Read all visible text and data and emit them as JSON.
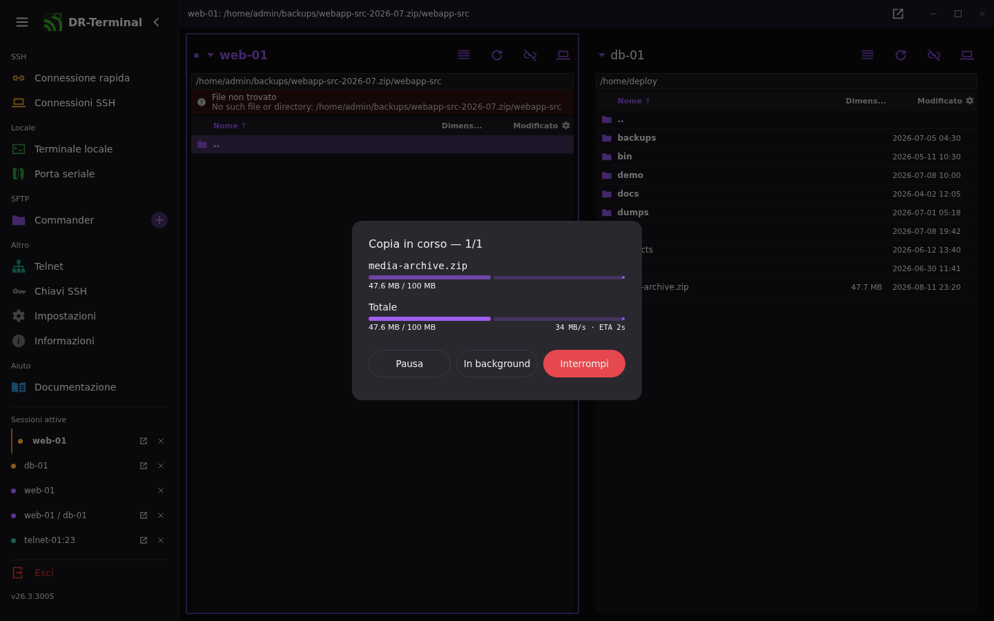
{
  "app": {
    "title": "DR-Terminal"
  },
  "sidebar": {
    "sections": [
      {
        "heading": "SSH",
        "items": [
          {
            "label": "Connessione rapida",
            "kind": "link"
          },
          {
            "label": "Connessioni SSH",
            "kind": "laptop"
          }
        ]
      },
      {
        "heading": "Locale",
        "items": [
          {
            "label": "Terminale locale",
            "kind": "terminal"
          },
          {
            "label": "Porta seriale",
            "kind": "serial"
          }
        ]
      },
      {
        "heading": "SFTP",
        "items": [
          {
            "label": "Commander",
            "kind": "folder",
            "add": true
          }
        ]
      },
      {
        "heading": "Altro",
        "items": [
          {
            "label": "Telnet",
            "kind": "network"
          },
          {
            "label": "Chiavi SSH",
            "kind": "key"
          },
          {
            "label": "Impostazioni",
            "kind": "gear"
          },
          {
            "label": "Informazioni",
            "kind": "info"
          }
        ]
      },
      {
        "heading": "Aiuto",
        "items": [
          {
            "label": "Documentazione",
            "kind": "book"
          }
        ]
      }
    ],
    "sessions_heading": "Sessioni attive",
    "sessions": [
      {
        "label": "web-01",
        "color": "#8a5a1e",
        "selected": true,
        "popout": true
      },
      {
        "label": "db-01",
        "color": "#8a5a1e",
        "selected": false,
        "popout": true
      },
      {
        "label": "web-01",
        "color": "#5a3590",
        "selected": false,
        "popout": false
      },
      {
        "label": "web-01 / db-01",
        "color": "#5a3590",
        "selected": false,
        "popout": true
      },
      {
        "label": "telnet-01:23",
        "color": "#1a5e55",
        "selected": false,
        "popout": true
      }
    ],
    "exit": "Esci",
    "version": "v26.3.3005"
  },
  "window": {
    "title": "web-01: /home/admin/backups/webapp-src-2026-07.zip/webapp-src"
  },
  "panels": [
    {
      "host": "web-01",
      "active": true,
      "path": "/home/admin/backups/webapp-src-2026-07.zip/webapp-src",
      "error": {
        "title": "File non trovato",
        "message": "No such file or directory: /home/admin/backups/webapp-src-2026-07.zip/webapp-src"
      },
      "columns": [
        "Nome ↑",
        "Dimens...",
        "Modificato"
      ],
      "rows": [
        {
          "name": "..",
          "kind": "folder",
          "selected": true
        }
      ]
    },
    {
      "host": "db-01",
      "active": false,
      "path": "/home/deploy",
      "columns": [
        "Nome ↑",
        "Dimens...",
        "Modificato"
      ],
      "rows": [
        {
          "name": "..",
          "kind": "folder",
          "selected": false
        },
        {
          "name": "backups",
          "kind": "folder",
          "modified": "2026-07-05 04:30",
          "selected": false
        },
        {
          "name": "bin",
          "kind": "folder",
          "modified": "2026-05-11 10:30",
          "selected": false
        },
        {
          "name": "demo",
          "kind": "folder",
          "modified": "2026-07-08 10:00",
          "selected": false
        },
        {
          "name": "docs",
          "kind": "folder",
          "modified": "2026-04-02 12:05",
          "selected": false
        },
        {
          "name": "dumps",
          "kind": "folder",
          "modified": "2026-07-01 05:18",
          "selected": false
        },
        {
          "modified": "2026-07-08 19:42",
          "selected": false
        },
        {
          "name": "cts",
          "covered": true,
          "modified": "2026-06-12 13:40",
          "selected": false
        },
        {
          "modified": "2026-06-30 11:41",
          "selected": false
        },
        {
          "name": "-archive.zip",
          "covered": true,
          "size": "47.7 MB",
          "modified": "2026-08-11 23:20",
          "selected": false
        }
      ]
    }
  ],
  "dialog": {
    "title": "Copia in corso — 1/1",
    "file": {
      "name": "media-archive.zip",
      "level": 0.476,
      "reading": "47.6 MB / 100 MB"
    },
    "total": {
      "label": "Totale",
      "level": 0.476,
      "reading": "47.6 MB / 100 MB",
      "rate": "34 MB/s · ETA 2s"
    },
    "buttons": [
      {
        "label": "Pausa",
        "kind": "outline"
      },
      {
        "label": "In background",
        "kind": "outline"
      },
      {
        "label": "Interrompi",
        "kind": "danger"
      }
    ]
  }
}
